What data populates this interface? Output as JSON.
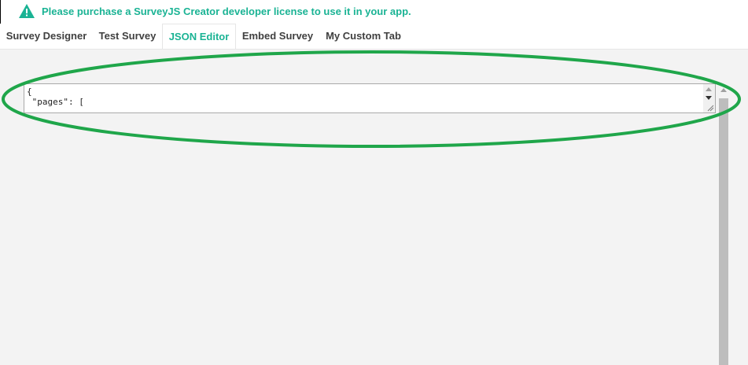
{
  "banner": {
    "message": "Please purchase a SurveyJS Creator developer license to use it in your app.",
    "icon": "warning-triangle-icon",
    "color": "#1ab394"
  },
  "tabs": [
    {
      "label": "Survey Designer",
      "active": false
    },
    {
      "label": "Test Survey",
      "active": false
    },
    {
      "label": "JSON Editor",
      "active": true
    },
    {
      "label": "Embed Survey",
      "active": false
    },
    {
      "label": "My Custom Tab",
      "active": false
    }
  ],
  "editor": {
    "lines": [
      "{",
      " \"pages\": ["
    ]
  },
  "colors": {
    "accent": "#1ab394",
    "annotation": "#1fa64a",
    "content_background": "#f3f3f3"
  }
}
